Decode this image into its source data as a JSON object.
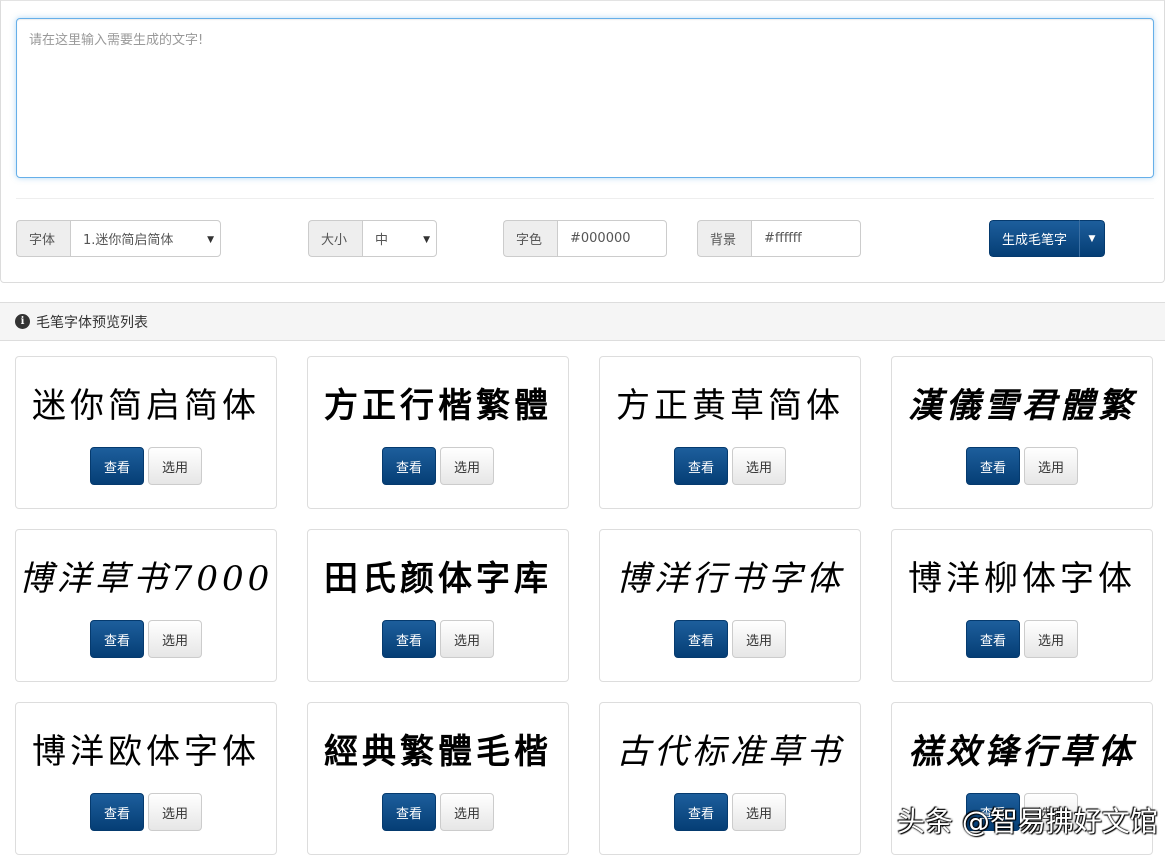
{
  "editor": {
    "placeholder": "请在这里输入需要生成的文字!"
  },
  "controls": {
    "font_label": "字体",
    "font_value": "1.迷你简启简体",
    "size_label": "大小",
    "size_value": "中",
    "color_label": "字色",
    "color_value": "#000000",
    "bg_label": "背景",
    "bg_value": "#ffffff",
    "generate_label": "生成毛笔字"
  },
  "list": {
    "title": "毛笔字体预览列表"
  },
  "fonts": [
    {
      "preview": "迷你简启简体",
      "view": "查看",
      "select": "选用"
    },
    {
      "preview": "方正行楷繁體",
      "view": "查看",
      "select": "选用"
    },
    {
      "preview": "方正黄草简体",
      "view": "查看",
      "select": "选用"
    },
    {
      "preview": "漢儀雪君體繁",
      "view": "查看",
      "select": "选用"
    },
    {
      "preview": "博洋草书7000",
      "view": "查看",
      "select": "选用"
    },
    {
      "preview": "田氏颜体字库",
      "view": "查看",
      "select": "选用"
    },
    {
      "preview": "博洋行书字体",
      "view": "查看",
      "select": "选用"
    },
    {
      "preview": "博洋柳体字体",
      "view": "查看",
      "select": "选用"
    },
    {
      "preview": "博洋欧体字体",
      "view": "查看",
      "select": "选用"
    },
    {
      "preview": "經典繁體毛楷",
      "view": "查看",
      "select": "选用"
    },
    {
      "preview": "古代标准草书",
      "view": "查看",
      "select": "选用"
    },
    {
      "preview": "禚效锋行草体",
      "view": "查看",
      "select": "选用"
    }
  ],
  "watermark": "头条 @智易拂好文馆"
}
